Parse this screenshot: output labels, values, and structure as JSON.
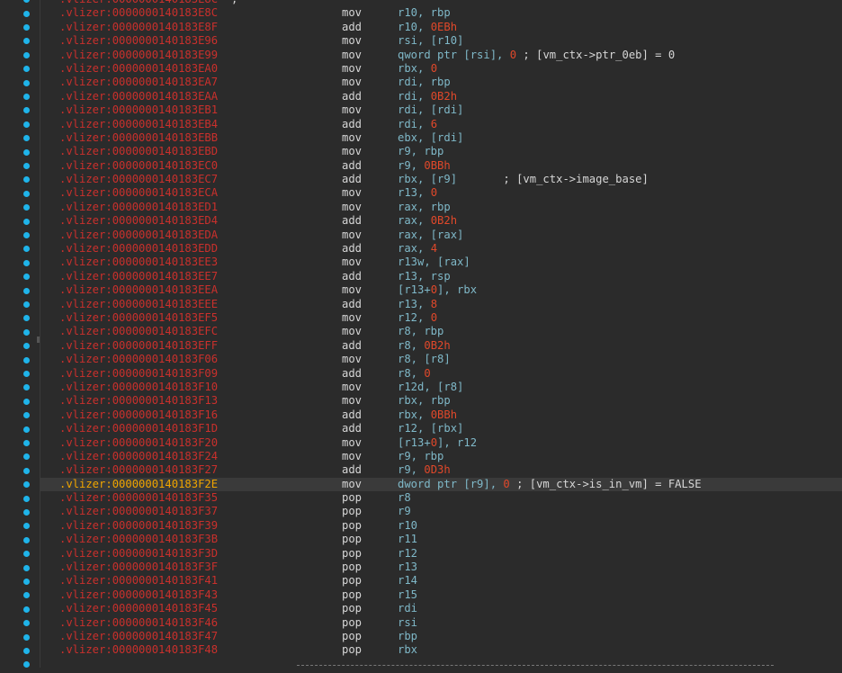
{
  "rows": [
    {
      "addr": ".vlizer:0000000140183E8C",
      "mn": "",
      "ops": "",
      "sep": true,
      "hl": false
    },
    {
      "addr": ".vlizer:0000000140183E8C",
      "mn": "mov",
      "ops": [
        {
          "t": "r10, rbp"
        }
      ],
      "hl": false
    },
    {
      "addr": ".vlizer:0000000140183E8F",
      "mn": "add",
      "ops": [
        {
          "t": "r10, "
        },
        {
          "n": "0EBh"
        }
      ],
      "hl": false
    },
    {
      "addr": ".vlizer:0000000140183E96",
      "mn": "mov",
      "ops": [
        {
          "t": "rsi, [r10]"
        }
      ],
      "hl": false
    },
    {
      "addr": ".vlizer:0000000140183E99",
      "mn": "mov",
      "ops": [
        {
          "t": "qword ptr [rsi], "
        },
        {
          "n": "0"
        },
        {
          "c": " ; [vm_ctx->ptr_0eb] = 0"
        }
      ],
      "hl": false
    },
    {
      "addr": ".vlizer:0000000140183EA0",
      "mn": "mov",
      "ops": [
        {
          "t": "rbx, "
        },
        {
          "n": "0"
        }
      ],
      "hl": false
    },
    {
      "addr": ".vlizer:0000000140183EA7",
      "mn": "mov",
      "ops": [
        {
          "t": "rdi, rbp"
        }
      ],
      "hl": false
    },
    {
      "addr": ".vlizer:0000000140183EAA",
      "mn": "add",
      "ops": [
        {
          "t": "rdi, "
        },
        {
          "n": "0B2h"
        }
      ],
      "hl": false
    },
    {
      "addr": ".vlizer:0000000140183EB1",
      "mn": "mov",
      "ops": [
        {
          "t": "rdi, [rdi]"
        }
      ],
      "hl": false
    },
    {
      "addr": ".vlizer:0000000140183EB4",
      "mn": "add",
      "ops": [
        {
          "t": "rdi, "
        },
        {
          "n": "6"
        }
      ],
      "hl": false
    },
    {
      "addr": ".vlizer:0000000140183EBB",
      "mn": "mov",
      "ops": [
        {
          "t": "ebx, [rdi]"
        }
      ],
      "hl": false
    },
    {
      "addr": ".vlizer:0000000140183EBD",
      "mn": "mov",
      "ops": [
        {
          "t": "r9, rbp"
        }
      ],
      "hl": false
    },
    {
      "addr": ".vlizer:0000000140183EC0",
      "mn": "add",
      "ops": [
        {
          "t": "r9, "
        },
        {
          "n": "0BBh"
        }
      ],
      "hl": false
    },
    {
      "addr": ".vlizer:0000000140183EC7",
      "mn": "add",
      "ops": [
        {
          "t": "rbx, [r9]"
        },
        {
          "c": "       ; [vm_ctx->image_base]"
        }
      ],
      "hl": false
    },
    {
      "addr": ".vlizer:0000000140183ECA",
      "mn": "mov",
      "ops": [
        {
          "t": "r13, "
        },
        {
          "n": "0"
        }
      ],
      "hl": false
    },
    {
      "addr": ".vlizer:0000000140183ED1",
      "mn": "mov",
      "ops": [
        {
          "t": "rax, rbp"
        }
      ],
      "hl": false
    },
    {
      "addr": ".vlizer:0000000140183ED4",
      "mn": "add",
      "ops": [
        {
          "t": "rax, "
        },
        {
          "n": "0B2h"
        }
      ],
      "hl": false
    },
    {
      "addr": ".vlizer:0000000140183EDA",
      "mn": "mov",
      "ops": [
        {
          "t": "rax, [rax]"
        }
      ],
      "hl": false
    },
    {
      "addr": ".vlizer:0000000140183EDD",
      "mn": "add",
      "ops": [
        {
          "t": "rax, "
        },
        {
          "n": "4"
        }
      ],
      "hl": false
    },
    {
      "addr": ".vlizer:0000000140183EE3",
      "mn": "mov",
      "ops": [
        {
          "t": "r13w, [rax]"
        }
      ],
      "hl": false
    },
    {
      "addr": ".vlizer:0000000140183EE7",
      "mn": "add",
      "ops": [
        {
          "t": "r13, rsp"
        }
      ],
      "hl": false
    },
    {
      "addr": ".vlizer:0000000140183EEA",
      "mn": "mov",
      "ops": [
        {
          "t": "[r13+"
        },
        {
          "n": "0"
        },
        {
          "t": "], rbx"
        }
      ],
      "hl": false
    },
    {
      "addr": ".vlizer:0000000140183EEE",
      "mn": "add",
      "ops": [
        {
          "t": "r13, "
        },
        {
          "n": "8"
        }
      ],
      "hl": false
    },
    {
      "addr": ".vlizer:0000000140183EF5",
      "mn": "mov",
      "ops": [
        {
          "t": "r12, "
        },
        {
          "n": "0"
        }
      ],
      "hl": false
    },
    {
      "addr": ".vlizer:0000000140183EFC",
      "mn": "mov",
      "ops": [
        {
          "t": "r8, rbp"
        }
      ],
      "hl": false
    },
    {
      "addr": ".vlizer:0000000140183EFF",
      "mn": "add",
      "ops": [
        {
          "t": "r8, "
        },
        {
          "n": "0B2h"
        }
      ],
      "hl": false
    },
    {
      "addr": ".vlizer:0000000140183F06",
      "mn": "mov",
      "ops": [
        {
          "t": "r8, [r8]"
        }
      ],
      "hl": false
    },
    {
      "addr": ".vlizer:0000000140183F09",
      "mn": "add",
      "ops": [
        {
          "t": "r8, "
        },
        {
          "n": "0"
        }
      ],
      "hl": false
    },
    {
      "addr": ".vlizer:0000000140183F10",
      "mn": "mov",
      "ops": [
        {
          "t": "r12d, [r8]"
        }
      ],
      "hl": false
    },
    {
      "addr": ".vlizer:0000000140183F13",
      "mn": "mov",
      "ops": [
        {
          "t": "rbx, rbp"
        }
      ],
      "hl": false
    },
    {
      "addr": ".vlizer:0000000140183F16",
      "mn": "add",
      "ops": [
        {
          "t": "rbx, "
        },
        {
          "n": "0BBh"
        }
      ],
      "hl": false
    },
    {
      "addr": ".vlizer:0000000140183F1D",
      "mn": "add",
      "ops": [
        {
          "t": "r12, [rbx]"
        }
      ],
      "hl": false
    },
    {
      "addr": ".vlizer:0000000140183F20",
      "mn": "mov",
      "ops": [
        {
          "t": "[r13+"
        },
        {
          "n": "0"
        },
        {
          "t": "], r12"
        }
      ],
      "hl": false
    },
    {
      "addr": ".vlizer:0000000140183F24",
      "mn": "mov",
      "ops": [
        {
          "t": "r9, rbp"
        }
      ],
      "hl": false
    },
    {
      "addr": ".vlizer:0000000140183F27",
      "mn": "add",
      "ops": [
        {
          "t": "r9, "
        },
        {
          "n": "0D3h"
        }
      ],
      "hl": false
    },
    {
      "addr": ".vlizer:0000000140183F2E",
      "mn": "mov",
      "ops": [
        {
          "t": "dword ptr [r9], "
        },
        {
          "n": "0"
        },
        {
          "c": " ; [vm_ctx->is_in_vm] = FALSE"
        }
      ],
      "hl": true
    },
    {
      "addr": ".vlizer:0000000140183F35",
      "mn": "pop",
      "ops": [
        {
          "t": "r8"
        }
      ],
      "hl": false
    },
    {
      "addr": ".vlizer:0000000140183F37",
      "mn": "pop",
      "ops": [
        {
          "t": "r9"
        }
      ],
      "hl": false
    },
    {
      "addr": ".vlizer:0000000140183F39",
      "mn": "pop",
      "ops": [
        {
          "t": "r10"
        }
      ],
      "hl": false
    },
    {
      "addr": ".vlizer:0000000140183F3B",
      "mn": "pop",
      "ops": [
        {
          "t": "r11"
        }
      ],
      "hl": false
    },
    {
      "addr": ".vlizer:0000000140183F3D",
      "mn": "pop",
      "ops": [
        {
          "t": "r12"
        }
      ],
      "hl": false
    },
    {
      "addr": ".vlizer:0000000140183F3F",
      "mn": "pop",
      "ops": [
        {
          "t": "r13"
        }
      ],
      "hl": false
    },
    {
      "addr": ".vlizer:0000000140183F41",
      "mn": "pop",
      "ops": [
        {
          "t": "r14"
        }
      ],
      "hl": false
    },
    {
      "addr": ".vlizer:0000000140183F43",
      "mn": "pop",
      "ops": [
        {
          "t": "r15"
        }
      ],
      "hl": false
    },
    {
      "addr": ".vlizer:0000000140183F45",
      "mn": "pop",
      "ops": [
        {
          "t": "rdi"
        }
      ],
      "hl": false
    },
    {
      "addr": ".vlizer:0000000140183F46",
      "mn": "pop",
      "ops": [
        {
          "t": "rsi"
        }
      ],
      "hl": false
    },
    {
      "addr": ".vlizer:0000000140183F47",
      "mn": "pop",
      "ops": [
        {
          "t": "rbp"
        }
      ],
      "hl": false
    },
    {
      "addr": ".vlizer:0000000140183F48",
      "mn": "pop",
      "ops": [
        {
          "t": "rbx"
        }
      ],
      "hl": false
    }
  ],
  "separator_comment": ";",
  "colors": {
    "background": "#2b2b2b",
    "address": "#c9302c",
    "highlight_address": "#f0a500",
    "operand": "#7fb8c8",
    "immediate": "#e0482a",
    "mnemonic": "#d6d6d6",
    "breakpoint_dot": "#1fb4ea"
  },
  "gutter_icon": "breakpoint-dot-icon"
}
